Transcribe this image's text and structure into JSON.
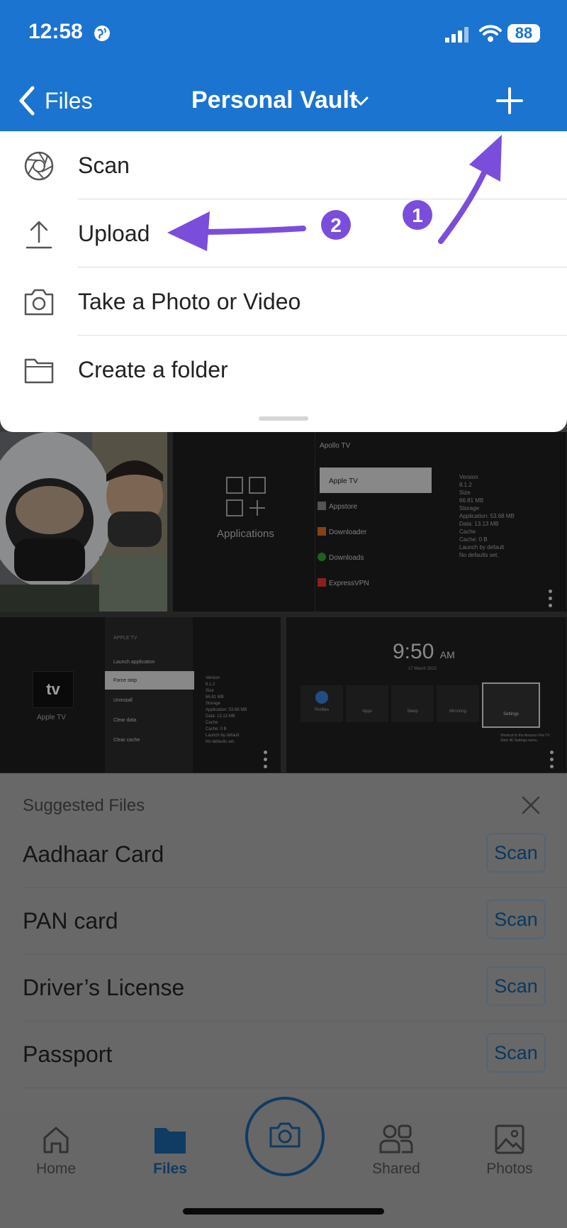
{
  "status": {
    "time": "12:58",
    "battery": "88"
  },
  "header": {
    "back_label": "Files",
    "title": "Personal Vault"
  },
  "menu": {
    "items": [
      {
        "label": "Scan",
        "icon": "aperture-icon"
      },
      {
        "label": "Upload",
        "icon": "upload-icon"
      },
      {
        "label": "Take a Photo or Video",
        "icon": "camera-icon"
      },
      {
        "label": "Create a folder",
        "icon": "folder-icon"
      }
    ]
  },
  "annotations": {
    "step1": "1",
    "step2": "2"
  },
  "grid": {
    "tile2": {
      "label": "Applications",
      "apps": [
        "Apollo TV",
        "Apple TV",
        "Appstore",
        "Downloader",
        "Downloads",
        "ExpressVPN"
      ],
      "details": [
        "Version",
        "8.1.2",
        "Size",
        "66.81 MB",
        "Storage",
        "Application: 53.68 MB",
        "Data: 13.13 MB",
        "Cache",
        "Cache: 0 B",
        "Launch by default",
        "No defaults set."
      ]
    },
    "tile3": {
      "brand": "tv",
      "caption": "Apple TV",
      "heading": "APPLE TV",
      "actions": [
        "Launch application",
        "Force stop",
        "Uninstall",
        "Clear data",
        "Clear cache"
      ],
      "details": [
        "Version",
        "8.1.2",
        "Size",
        "66.81 MB",
        "Storage",
        "Application: 53.68 MB",
        "Data: 13.13 MB",
        "Cache",
        "Cache: 0 B",
        "Launch by default",
        "No defaults set."
      ]
    },
    "tile4": {
      "clock": "9:50",
      "ampm": "AM",
      "date": "17 March 2022",
      "tiles": [
        "Profiles",
        "Apps",
        "Sleep",
        "Mirroring",
        "Settings"
      ],
      "note": "Shortcut to the Amazon Fire TV Stick 4K Settings menu."
    }
  },
  "suggested": {
    "title": "Suggested Files",
    "items": [
      {
        "label": "Aadhaar Card",
        "action": "Scan"
      },
      {
        "label": "PAN card",
        "action": "Scan"
      },
      {
        "label": "Driver’s License",
        "action": "Scan"
      },
      {
        "label": "Passport",
        "action": "Scan"
      }
    ]
  },
  "tabs": [
    {
      "label": "Home",
      "icon": "home-icon"
    },
    {
      "label": "Files",
      "icon": "folder-icon"
    },
    {
      "label": "Shared",
      "icon": "people-icon"
    },
    {
      "label": "Photos",
      "icon": "image-icon"
    }
  ],
  "colors": {
    "brand": "#1b74d0",
    "annotation": "#7b4ddb",
    "tab_active": "#1b5f9e"
  }
}
